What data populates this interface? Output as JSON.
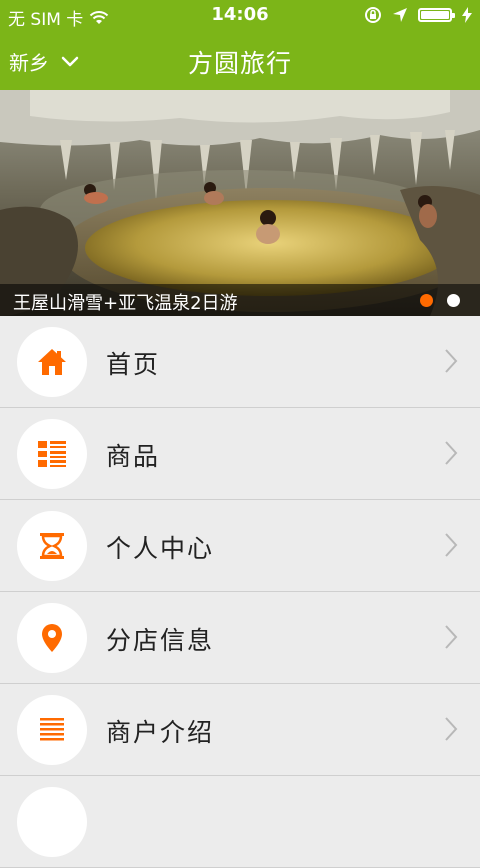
{
  "status_bar": {
    "carrier": "无 SIM 卡",
    "time": "14:06",
    "battery_level": 1.0
  },
  "nav": {
    "city": "新乡",
    "title": "方圆旅行"
  },
  "banner": {
    "caption": "王屋山滑雪+亚飞温泉2日游",
    "slide_count": 2,
    "active_slide": 1
  },
  "menu": [
    {
      "label": "首页",
      "icon": "home-icon"
    },
    {
      "label": "商品",
      "icon": "list-grid-icon"
    },
    {
      "label": "个人中心",
      "icon": "hourglass-icon"
    },
    {
      "label": "分店信息",
      "icon": "location-pin-icon"
    },
    {
      "label": "商户介绍",
      "icon": "lines-icon"
    }
  ],
  "colors": {
    "brand_green": "#7cb518",
    "accent_orange": "#ff6a00"
  }
}
